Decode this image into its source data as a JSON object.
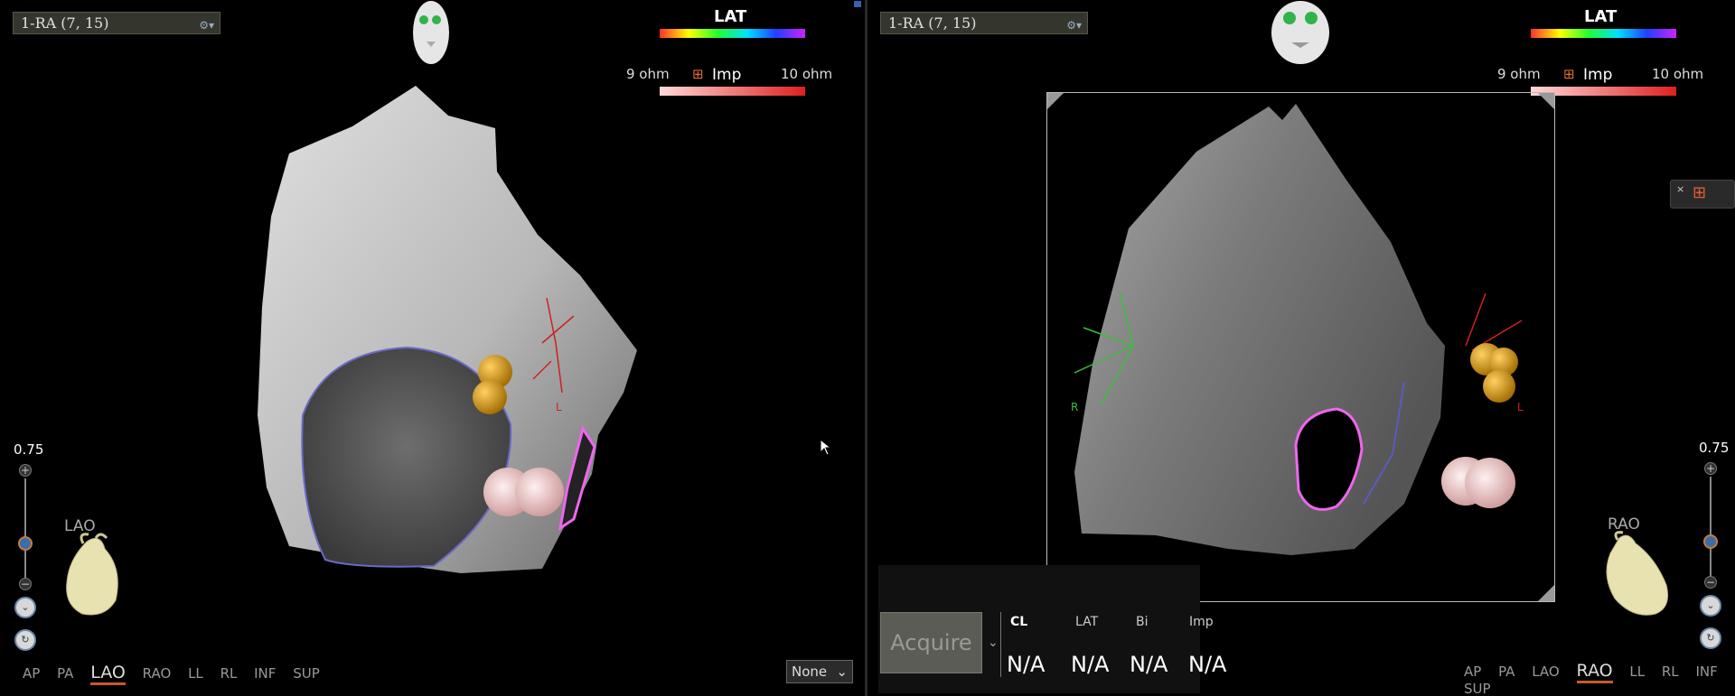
{
  "left": {
    "map_name": "1-RA (7, 15)",
    "legend_lat_title": "LAT",
    "imp_min": "9 ohm",
    "imp_label": "Imp",
    "imp_max": "10 ohm",
    "zoom_value": "0.75",
    "zoom_level": 0.5,
    "orientation_label": "LAO",
    "views": [
      "AP",
      "PA",
      "LAO",
      "RAO",
      "LL",
      "RL",
      "INF",
      "SUP"
    ],
    "active_view": "LAO",
    "dropdown_value": "None",
    "catheter_label": "L"
  },
  "right": {
    "map_name": "1-RA (7, 15)",
    "legend_lat_title": "LAT",
    "imp_min": "9 ohm",
    "imp_label": "Imp",
    "imp_max": "10 ohm",
    "zoom_value": "0.75",
    "zoom_level": 0.5,
    "orientation_label": "RAO",
    "views": [
      "AP",
      "PA",
      "LAO",
      "RAO",
      "LL",
      "RL",
      "INF",
      "SUP"
    ],
    "active_view": "RAO",
    "acquire_label": "Acquire",
    "stats": [
      {
        "label": "CL",
        "value": "N/A"
      },
      {
        "label": "LAT",
        "value": "N/A"
      },
      {
        "label": "Bi",
        "value": "N/A"
      },
      {
        "label": "Imp",
        "value": "N/A"
      }
    ],
    "catheter_label_left": "R",
    "catheter_label_right": "L"
  },
  "colors": {
    "lat_gradient": [
      "#ff0000",
      "#ffff00",
      "#00ff00",
      "#00ffff",
      "#0000ff",
      "#ff00ff"
    ],
    "imp_gradient": [
      "#ffd0d0",
      "#e03030"
    ],
    "active_underline": "#c85a2a"
  },
  "icons": [
    "face-orientation-icon",
    "heart-orientation-icon",
    "zoom-in-icon",
    "zoom-out-icon",
    "mouse-cursor-icon",
    "catheter-tool-icon"
  ]
}
